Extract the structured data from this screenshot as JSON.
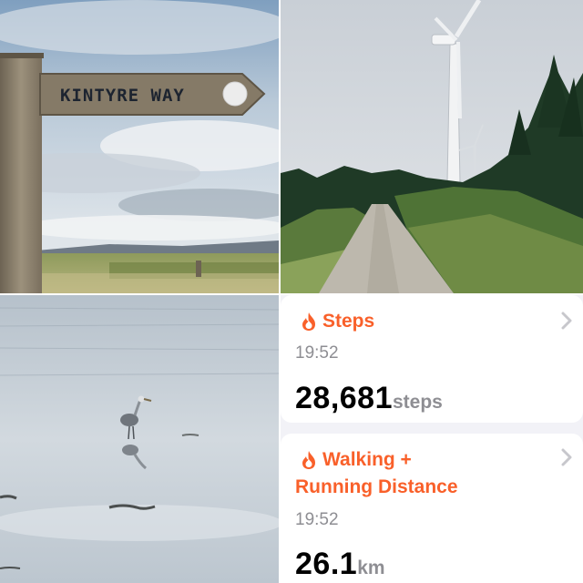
{
  "signpost": {
    "text": "KINTYRE WAY",
    "badge_text": "Kintyre Way"
  },
  "steps_card": {
    "title": "Steps",
    "time": "19:52",
    "value": "28,681",
    "unit": "steps"
  },
  "distance_card": {
    "title_line1": "Walking +",
    "title_line2": "Running Distance",
    "time": "19:52",
    "value": "26.1",
    "unit": "km"
  },
  "colors": {
    "accent": "#f9602a",
    "secondary_text": "#8e8e93",
    "card_bg": "#ffffff",
    "panel_bg": "#f2f2f7"
  },
  "icons": {
    "title_icon": "flame-icon",
    "disclosure_icon": "chevron-right-icon"
  }
}
